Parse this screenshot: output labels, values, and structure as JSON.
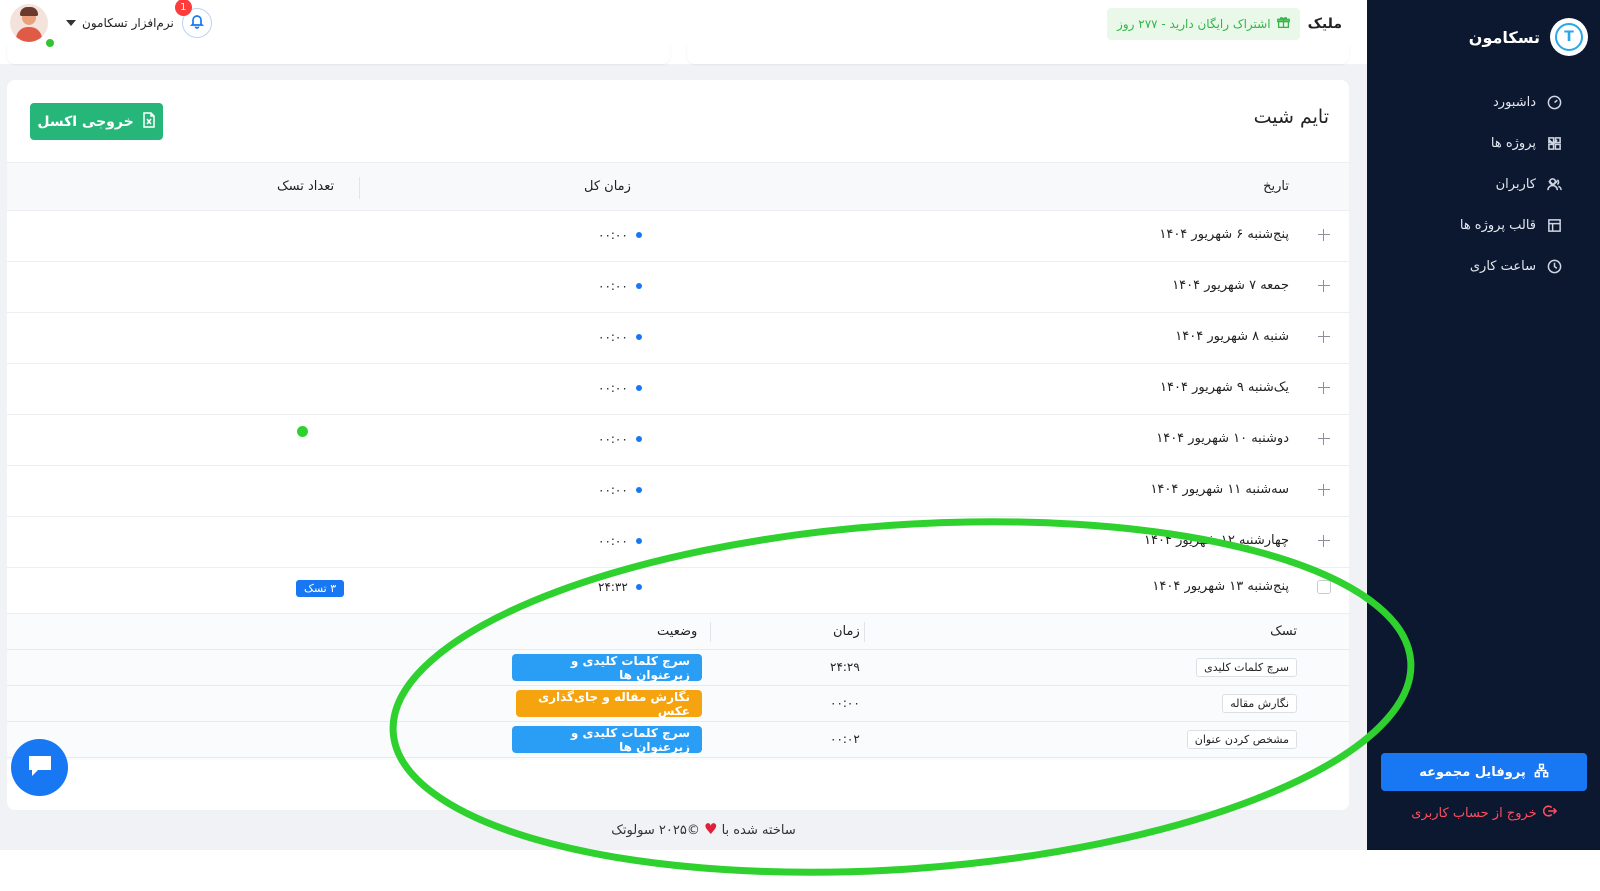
{
  "sidebar": {
    "brand_name": "تسکامون",
    "brand_logo_letter": "T",
    "items": [
      {
        "label": "داشبورد",
        "icon": "dashboard-icon",
        "has_chevron": false
      },
      {
        "label": "پروژه ها",
        "icon": "grid-icon",
        "has_chevron": true
      },
      {
        "label": "کاربران",
        "icon": "users-icon",
        "has_chevron": true
      },
      {
        "label": "قالب پروژه ها",
        "icon": "template-icon",
        "has_chevron": false
      },
      {
        "label": "ساعت کاری",
        "icon": "clock-icon",
        "has_chevron": false
      }
    ],
    "profile_button": "پروفایل مجموعه",
    "logout": "خروج از حساب کاربری"
  },
  "topbar": {
    "company": "ملیک",
    "subscription": "اشتراک رایگان دارید - ۲۷۷ روز",
    "user_name": "نرم‌افزار تسکامون",
    "notification_count": "1"
  },
  "page": {
    "title": "تایم شیت",
    "excel_button": "خروجی اکسل",
    "columns": {
      "date": "تاریخ",
      "total_time": "زمان کل",
      "task_count": "تعداد تسک"
    },
    "rows": [
      {
        "date": "پنج‌شنبه ۶ شهریور ۱۴۰۴",
        "time": "۰۰:۰۰",
        "tasks": ""
      },
      {
        "date": "جمعه ۷ شهریور ۱۴۰۴",
        "time": "۰۰:۰۰",
        "tasks": ""
      },
      {
        "date": "شنبه ۸ شهریور ۱۴۰۴",
        "time": "۰۰:۰۰",
        "tasks": ""
      },
      {
        "date": "یک‌شنبه ۹ شهریور ۱۴۰۴",
        "time": "۰۰:۰۰",
        "tasks": ""
      },
      {
        "date": "دوشنبه ۱۰ شهریور ۱۴۰۴",
        "time": "۰۰:۰۰",
        "tasks": ""
      },
      {
        "date": "سه‌شنبه ۱۱ شهریور ۱۴۰۴",
        "time": "۰۰:۰۰",
        "tasks": ""
      },
      {
        "date": "چهارشنبه ۱۲ شهریور ۱۴۰۴",
        "time": "۰۰:۰۰",
        "tasks": ""
      },
      {
        "date": "پنج‌شنبه ۱۳ شهریور ۱۴۰۴",
        "time": "۲۴:۳۲",
        "tasks": "۳ تسک"
      }
    ],
    "subtable": {
      "columns": {
        "task": "تسک",
        "time": "زمان",
        "status": "وضعیت"
      },
      "rows": [
        {
          "task": "سرچ کلمات کلیدی",
          "time": "۲۴:۲۹",
          "status": "سرچ کلمات کلیدی و زیرعنوان ها",
          "status_color": "#2a9df4"
        },
        {
          "task": "نگارش مقاله",
          "time": "۰۰:۰۰",
          "status": "نگارش مقاله و جای‌گذاری عکس",
          "status_color": "#f5a30f"
        },
        {
          "task": "مشخص کردن عنوان",
          "time": "۰۰:۰۲",
          "status": "سرچ کلمات کلیدی و زیرعنوان ها",
          "status_color": "#2a9df4"
        }
      ]
    }
  },
  "footer": {
    "prefix": "ساخته شده با",
    "suffix": "©۲۰۲۵ سولوتک"
  },
  "colors": {
    "sidebar_bg": "#0c1730",
    "primary": "#1877f2",
    "excel": "#27b67a",
    "annotation": "#2fd12f"
  }
}
